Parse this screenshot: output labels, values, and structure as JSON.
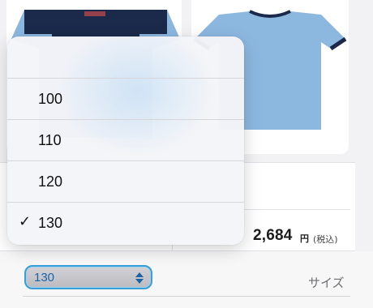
{
  "product": {
    "price_value": "2,684",
    "price_unit": "円",
    "price_tax_note": "(税込)"
  },
  "size_field": {
    "label": "サイズ",
    "selected_value": "130"
  },
  "dropdown": {
    "options": [
      {
        "label": "100",
        "selected": false
      },
      {
        "label": "110",
        "selected": false
      },
      {
        "label": "120",
        "selected": false
      },
      {
        "label": "130",
        "selected": true
      }
    ],
    "check_glyph": "✓"
  },
  "colors": {
    "shirt_body": "#8cb8e0",
    "shirt_trim": "#1b2a4a",
    "select_border": "#3a9fd6",
    "select_text": "#1a63a8"
  },
  "icons": {
    "select_arrows": "chevron-up-down-icon",
    "check": "checkmark-icon"
  }
}
